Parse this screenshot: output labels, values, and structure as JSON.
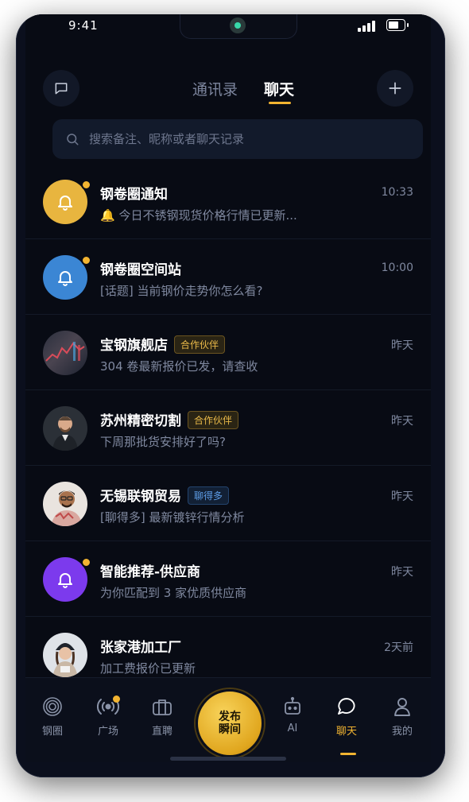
{
  "status": {
    "time": "9:41"
  },
  "header": {
    "tabs": [
      {
        "label": "通讯录"
      },
      {
        "label": "聊天"
      }
    ],
    "active_tab": "聊天"
  },
  "search": {
    "placeholder": "搜索备注、昵称或者聊天记录"
  },
  "chats": [
    {
      "name": "钢卷圈通知",
      "preview": "🔔 今日不锈钢现货价格行情已更新...",
      "time": "10:33",
      "avatar": "bell-icon",
      "avatar_color": "#e8b53f",
      "unread": true,
      "badge": ""
    },
    {
      "name": "钢卷圈空间站",
      "preview": "[话题] 当前钢价走势你怎么看?",
      "time": "10:00",
      "avatar": "bell-icon",
      "avatar_color": "#3b86d4",
      "unread": true,
      "badge": ""
    },
    {
      "name": "宝钢旗舰店",
      "preview": "304 卷最新报价已发，请查收",
      "time": "昨天",
      "avatar": "store-photo",
      "unread": false,
      "badge": "合作伙伴"
    },
    {
      "name": "苏州精密切割",
      "preview": "下周那批货安排好了吗?",
      "time": "昨天",
      "avatar": "person-photo",
      "unread": false,
      "badge": "合作伙伴"
    },
    {
      "name": "无锡联钢贸易",
      "preview": "[聊得多] 最新镀锌行情分析",
      "time": "昨天",
      "avatar": "person-photo",
      "unread": false,
      "badge": "聊得多"
    },
    {
      "name": "智能推荐-供应商",
      "preview": "为你匹配到 3 家优质供应商",
      "time": "昨天",
      "avatar": "bell-icon",
      "avatar_color": "#7c3aed",
      "unread": true,
      "badge": ""
    },
    {
      "name": "张家港加工厂",
      "preview": "加工费报价已更新",
      "time": "2天前",
      "avatar": "person-photo",
      "unread": false,
      "badge": ""
    }
  ],
  "tabbar": {
    "items": [
      {
        "label": "钢圈",
        "icon": "ring-icon"
      },
      {
        "label": "广场",
        "icon": "broadcast-icon"
      },
      {
        "label": "直聘",
        "icon": "briefcase-icon"
      },
      {
        "label": "AI",
        "icon": "robot-icon"
      },
      {
        "label": "聊天",
        "icon": "chat-bubble-icon"
      },
      {
        "label": "我的",
        "icon": "user-icon"
      }
    ],
    "publish": {
      "line1": "发布",
      "line2": "瞬间"
    },
    "active": "聊天"
  },
  "colors": {
    "accent": "#f2b431",
    "background": "#080b14"
  }
}
